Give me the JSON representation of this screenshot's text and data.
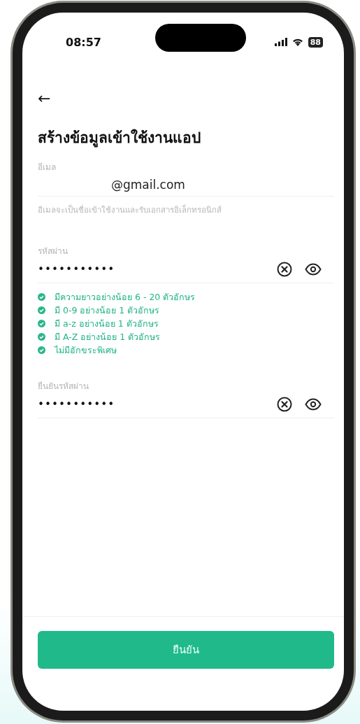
{
  "status_bar": {
    "time": "08:57",
    "battery": "88"
  },
  "back_button": {
    "label": "←"
  },
  "title": "สร้างข้อมูลเข้าใช้งานแอป",
  "email_field": {
    "label": "อีเมล",
    "value": "@gmail.com",
    "helper": "อีเมลจะเป็นชื่อเข้าใช้งานและรับเอกสารอิเล็กทรอนิกส์"
  },
  "password_field": {
    "label": "รหัสผ่าน",
    "value": "•••••••••••"
  },
  "password_rules": [
    {
      "text": "มีความยาวอย่างน้อย 6 - 20 ตัวอักษร",
      "met": true
    },
    {
      "text": "มี 0-9 อย่างน้อย 1 ตัวอักษร",
      "met": true
    },
    {
      "text": "มี a-z อย่างน้อย 1 ตัวอักษร",
      "met": true
    },
    {
      "text": "มี A-Z อย่างน้อย 1 ตัวอักษร",
      "met": true
    },
    {
      "text": "ไม่มีอักขระพิเศษ",
      "met": true
    }
  ],
  "confirm_password_field": {
    "label": "ยืนยันรหัสผ่าน",
    "value": "•••••••••••"
  },
  "confirm_button": {
    "label": "ยืนยัน"
  }
}
